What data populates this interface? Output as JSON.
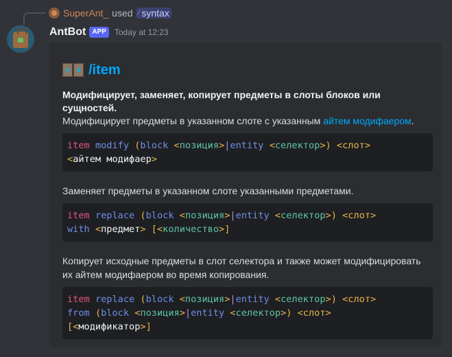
{
  "reply": {
    "user": "SuperAnt_",
    "used_text": "used",
    "command": "syntax"
  },
  "message": {
    "author": "AntBot",
    "tag": "APP",
    "timestamp": "Today at 12:23"
  },
  "embed": {
    "title": "/item",
    "bold_description": "Модифицирует, заменяет, копирует предметы в слоты блоков или сущностей.",
    "description_prefix": "Модифицирует предметы в указанном слоте с указанным ",
    "description_link": "айтем модифаером",
    "description_suffix": ".",
    "code1": {
      "line1": [
        "item",
        "modify",
        "(",
        "block",
        "<",
        "позиция",
        ">",
        "|",
        "entity",
        "<",
        "селектор",
        ">",
        ")",
        "<слот>"
      ],
      "line2": [
        "<",
        "айтем модифаер",
        ">"
      ]
    },
    "para2": "Заменяет предметы в указанном слоте указанными предметами.",
    "code2": {
      "line1": [
        "item",
        "replace",
        "(",
        "block",
        "<",
        "позиция",
        ">",
        "|",
        "entity",
        "<",
        "селектор",
        ">",
        ")",
        "<слот>"
      ],
      "line2": [
        "with",
        "<",
        "предмет",
        ">",
        "[",
        "<",
        "количество",
        ">",
        "]"
      ]
    },
    "para3": "Копирует исходные предметы в слот селектора и также может модифицировать их айтем модифаером во время копирования.",
    "code3": {
      "line1": [
        "item",
        "replace",
        "(",
        "block",
        "<",
        "позиция",
        ">",
        "|",
        "entity",
        "<",
        "селектор",
        ">",
        ")",
        "<слот>"
      ],
      "line2": [
        "from",
        "(",
        "block",
        "<",
        "позиция",
        ">",
        "|",
        "entity",
        "<",
        "селектор",
        ">",
        ")",
        "<слот>"
      ],
      "line3": [
        "[",
        "<",
        "модификатор",
        ">",
        "]"
      ]
    }
  }
}
